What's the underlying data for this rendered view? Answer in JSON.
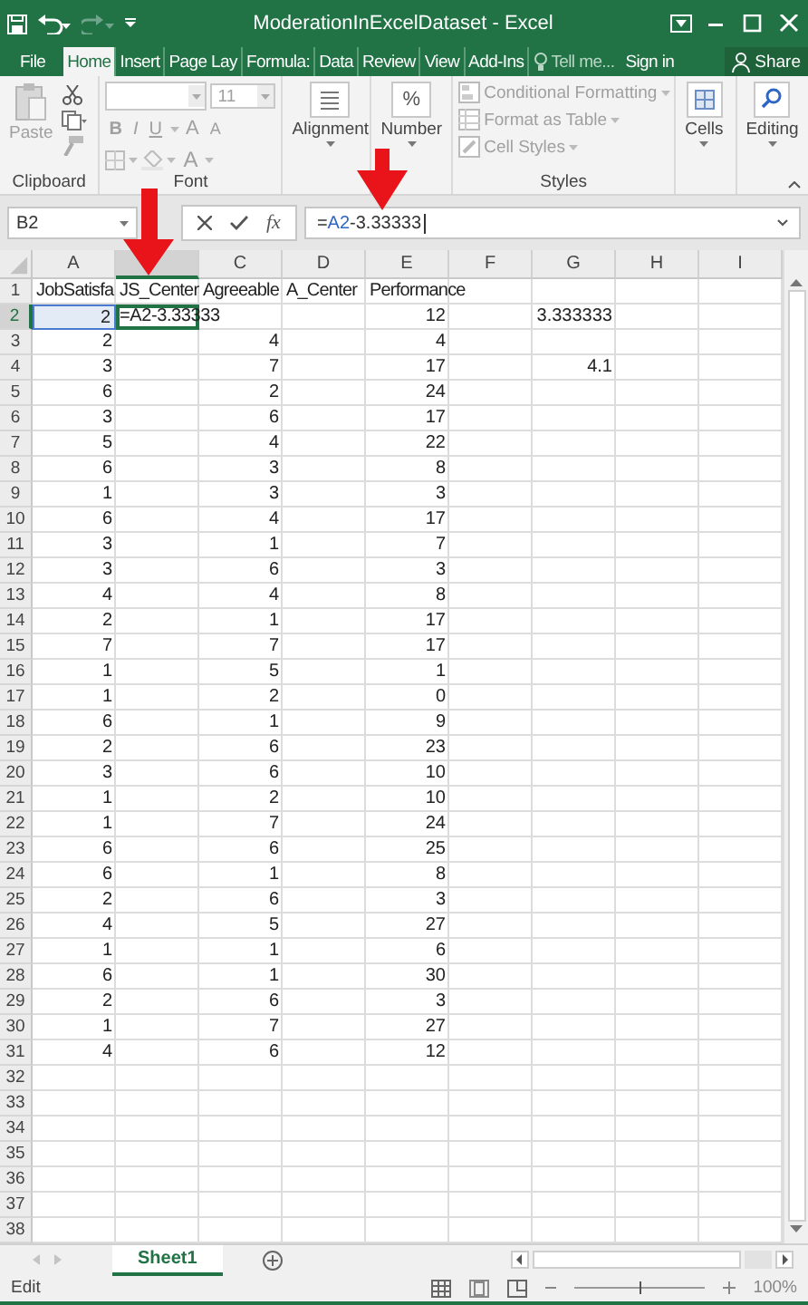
{
  "window": {
    "title": "ModerationInExcelDataset - Excel"
  },
  "ribbon_tabs": [
    {
      "label": "File",
      "selected": false
    },
    {
      "label": "Home",
      "selected": true
    },
    {
      "label": "Insert",
      "selected": false
    },
    {
      "label": "Page Lay",
      "selected": false
    },
    {
      "label": "Formula:",
      "selected": false
    },
    {
      "label": "Data",
      "selected": false
    },
    {
      "label": "Review",
      "selected": false
    },
    {
      "label": "View",
      "selected": false
    },
    {
      "label": "Add-Ins",
      "selected": false
    }
  ],
  "tell_me": {
    "placeholder": "Tell me..."
  },
  "account": {
    "sign_in": "Sign in",
    "share": "Share"
  },
  "ribbon": {
    "clipboard": {
      "label": "Clipboard",
      "paste": "Paste"
    },
    "font": {
      "label": "Font",
      "size": "11",
      "style_buttons": [
        "B",
        "I",
        "U"
      ],
      "size_buttons": [
        "A",
        "A"
      ],
      "color_button": "A"
    },
    "alignment": {
      "label": "Alignment"
    },
    "number": {
      "label": "Number",
      "symbol": "%"
    },
    "styles": {
      "label": "Styles",
      "items": [
        {
          "label": "Conditional Formatting",
          "disabled": true
        },
        {
          "label": "Format as Table",
          "disabled": true
        },
        {
          "label": "Cell Styles",
          "disabled": true
        }
      ]
    },
    "cells": {
      "label": "Cells"
    },
    "editing": {
      "label": "Editing"
    }
  },
  "formula_bar": {
    "name_box": "B2",
    "function_label": "fx",
    "formula": [
      {
        "text": "=",
        "kind": "plain"
      },
      {
        "text": "A2",
        "kind": "reference"
      },
      {
        "text": "-3.33333",
        "kind": "plain"
      }
    ]
  },
  "columns": [
    {
      "label": "A",
      "selected": false
    },
    {
      "selected": true
    },
    {
      "label": "C",
      "selected": false
    },
    {
      "label": "D",
      "selected": false
    },
    {
      "label": "E",
      "selected": false
    },
    {
      "label": "F",
      "selected": false
    },
    {
      "label": "G",
      "selected": false
    },
    {
      "label": "H",
      "selected": false
    },
    {
      "label": "I",
      "selected": false
    }
  ],
  "rows": [
    {
      "label": "1",
      "selected": false,
      "cells": [
        {
          "text": "JobSatisfa",
          "kind": "label"
        },
        {
          "text": "JS_Center",
          "kind": "label"
        },
        {
          "text": "Agreeable",
          "kind": "label"
        },
        {
          "text": "A_Center",
          "kind": "label"
        },
        {
          "text": "Performance",
          "kind": "label"
        }
      ]
    },
    {
      "label": "2",
      "selected": true,
      "cells": [
        {
          "text": "2",
          "kind": "reference"
        },
        {
          "text": "=A2-3.33333",
          "kind": "editing"
        },
        {
          "kind": "blank"
        },
        {
          "kind": "blank"
        },
        {
          "text": "12",
          "kind": "number"
        },
        {
          "kind": "blank"
        },
        {
          "text": "3.333333",
          "kind": "number"
        }
      ]
    },
    {
      "label": "3",
      "selected": false,
      "cells": [
        {
          "text": "2",
          "kind": "number"
        },
        {
          "kind": "blank"
        },
        {
          "text": "4",
          "kind": "number"
        },
        {
          "kind": "blank"
        },
        {
          "text": "4",
          "kind": "number"
        }
      ]
    },
    {
      "label": "4",
      "selected": false,
      "cells": [
        {
          "text": "3",
          "kind": "number"
        },
        {
          "kind": "blank"
        },
        {
          "text": "7",
          "kind": "number"
        },
        {
          "kind": "blank"
        },
        {
          "text": "17",
          "kind": "number"
        },
        {
          "kind": "blank"
        },
        {
          "text": "4.1",
          "kind": "number"
        }
      ]
    },
    {
      "label": "5",
      "selected": false,
      "cells": [
        {
          "text": "6",
          "kind": "number"
        },
        {
          "kind": "blank"
        },
        {
          "text": "2",
          "kind": "number"
        },
        {
          "kind": "blank"
        },
        {
          "text": "24",
          "kind": "number"
        }
      ]
    },
    {
      "label": "6",
      "selected": false,
      "cells": [
        {
          "text": "3",
          "kind": "number"
        },
        {
          "kind": "blank"
        },
        {
          "text": "6",
          "kind": "number"
        },
        {
          "kind": "blank"
        },
        {
          "text": "17",
          "kind": "number"
        }
      ]
    },
    {
      "label": "7",
      "selected": false,
      "cells": [
        {
          "text": "5",
          "kind": "number"
        },
        {
          "kind": "blank"
        },
        {
          "text": "4",
          "kind": "number"
        },
        {
          "kind": "blank"
        },
        {
          "text": "22",
          "kind": "number"
        }
      ]
    },
    {
      "label": "8",
      "selected": false,
      "cells": [
        {
          "text": "6",
          "kind": "number"
        },
        {
          "kind": "blank"
        },
        {
          "text": "3",
          "kind": "number"
        },
        {
          "kind": "blank"
        },
        {
          "text": "8",
          "kind": "number"
        }
      ]
    },
    {
      "label": "9",
      "selected": false,
      "cells": [
        {
          "text": "1",
          "kind": "number"
        },
        {
          "kind": "blank"
        },
        {
          "text": "3",
          "kind": "number"
        },
        {
          "kind": "blank"
        },
        {
          "text": "3",
          "kind": "number"
        }
      ]
    },
    {
      "label": "10",
      "selected": false,
      "cells": [
        {
          "text": "6",
          "kind": "number"
        },
        {
          "kind": "blank"
        },
        {
          "text": "4",
          "kind": "number"
        },
        {
          "kind": "blank"
        },
        {
          "text": "17",
          "kind": "number"
        }
      ]
    },
    {
      "label": "11",
      "selected": false,
      "cells": [
        {
          "text": "3",
          "kind": "number"
        },
        {
          "kind": "blank"
        },
        {
          "text": "1",
          "kind": "number"
        },
        {
          "kind": "blank"
        },
        {
          "text": "7",
          "kind": "number"
        }
      ]
    },
    {
      "label": "12",
      "selected": false,
      "cells": [
        {
          "text": "3",
          "kind": "number"
        },
        {
          "kind": "blank"
        },
        {
          "text": "6",
          "kind": "number"
        },
        {
          "kind": "blank"
        },
        {
          "text": "3",
          "kind": "number"
        }
      ]
    },
    {
      "label": "13",
      "selected": false,
      "cells": [
        {
          "text": "4",
          "kind": "number"
        },
        {
          "kind": "blank"
        },
        {
          "text": "4",
          "kind": "number"
        },
        {
          "kind": "blank"
        },
        {
          "text": "8",
          "kind": "number"
        }
      ]
    },
    {
      "label": "14",
      "selected": false,
      "cells": [
        {
          "text": "2",
          "kind": "number"
        },
        {
          "kind": "blank"
        },
        {
          "text": "1",
          "kind": "number"
        },
        {
          "kind": "blank"
        },
        {
          "text": "17",
          "kind": "number"
        }
      ]
    },
    {
      "label": "15",
      "selected": false,
      "cells": [
        {
          "text": "7",
          "kind": "number"
        },
        {
          "kind": "blank"
        },
        {
          "text": "7",
          "kind": "number"
        },
        {
          "kind": "blank"
        },
        {
          "text": "17",
          "kind": "number"
        }
      ]
    },
    {
      "label": "16",
      "selected": false,
      "cells": [
        {
          "text": "1",
          "kind": "number"
        },
        {
          "kind": "blank"
        },
        {
          "text": "5",
          "kind": "number"
        },
        {
          "kind": "blank"
        },
        {
          "text": "1",
          "kind": "number"
        }
      ]
    },
    {
      "label": "17",
      "selected": false,
      "cells": [
        {
          "text": "1",
          "kind": "number"
        },
        {
          "kind": "blank"
        },
        {
          "text": "2",
          "kind": "number"
        },
        {
          "kind": "blank"
        },
        {
          "text": "0",
          "kind": "number"
        }
      ]
    },
    {
      "label": "18",
      "selected": false,
      "cells": [
        {
          "text": "6",
          "kind": "number"
        },
        {
          "kind": "blank"
        },
        {
          "text": "1",
          "kind": "number"
        },
        {
          "kind": "blank"
        },
        {
          "text": "9",
          "kind": "number"
        }
      ]
    },
    {
      "label": "19",
      "selected": false,
      "cells": [
        {
          "text": "2",
          "kind": "number"
        },
        {
          "kind": "blank"
        },
        {
          "text": "6",
          "kind": "number"
        },
        {
          "kind": "blank"
        },
        {
          "text": "23",
          "kind": "number"
        }
      ]
    },
    {
      "label": "20",
      "selected": false,
      "cells": [
        {
          "text": "3",
          "kind": "number"
        },
        {
          "kind": "blank"
        },
        {
          "text": "6",
          "kind": "number"
        },
        {
          "kind": "blank"
        },
        {
          "text": "10",
          "kind": "number"
        }
      ]
    },
    {
      "label": "21",
      "selected": false,
      "cells": [
        {
          "text": "1",
          "kind": "number"
        },
        {
          "kind": "blank"
        },
        {
          "text": "2",
          "kind": "number"
        },
        {
          "kind": "blank"
        },
        {
          "text": "10",
          "kind": "number"
        }
      ]
    },
    {
      "label": "22",
      "selected": false,
      "cells": [
        {
          "text": "1",
          "kind": "number"
        },
        {
          "kind": "blank"
        },
        {
          "text": "7",
          "kind": "number"
        },
        {
          "kind": "blank"
        },
        {
          "text": "24",
          "kind": "number"
        }
      ]
    },
    {
      "label": "23",
      "selected": false,
      "cells": [
        {
          "text": "6",
          "kind": "number"
        },
        {
          "kind": "blank"
        },
        {
          "text": "6",
          "kind": "number"
        },
        {
          "kind": "blank"
        },
        {
          "text": "25",
          "kind": "number"
        }
      ]
    },
    {
      "label": "24",
      "selected": false,
      "cells": [
        {
          "text": "6",
          "kind": "number"
        },
        {
          "kind": "blank"
        },
        {
          "text": "1",
          "kind": "number"
        },
        {
          "kind": "blank"
        },
        {
          "text": "8",
          "kind": "number"
        }
      ]
    },
    {
      "label": "25",
      "selected": false,
      "cells": [
        {
          "text": "2",
          "kind": "number"
        },
        {
          "kind": "blank"
        },
        {
          "text": "6",
          "kind": "number"
        },
        {
          "kind": "blank"
        },
        {
          "text": "3",
          "kind": "number"
        }
      ]
    },
    {
      "label": "26",
      "selected": false,
      "cells": [
        {
          "text": "4",
          "kind": "number"
        },
        {
          "kind": "blank"
        },
        {
          "text": "5",
          "kind": "number"
        },
        {
          "kind": "blank"
        },
        {
          "text": "27",
          "kind": "number"
        }
      ]
    },
    {
      "label": "27",
      "selected": false,
      "cells": [
        {
          "text": "1",
          "kind": "number"
        },
        {
          "kind": "blank"
        },
        {
          "text": "1",
          "kind": "number"
        },
        {
          "kind": "blank"
        },
        {
          "text": "6",
          "kind": "number"
        }
      ]
    },
    {
      "label": "28",
      "selected": false,
      "cells": [
        {
          "text": "6",
          "kind": "number"
        },
        {
          "kind": "blank"
        },
        {
          "text": "1",
          "kind": "number"
        },
        {
          "kind": "blank"
        },
        {
          "text": "30",
          "kind": "number"
        }
      ]
    },
    {
      "label": "29",
      "selected": false,
      "cells": [
        {
          "text": "2",
          "kind": "number"
        },
        {
          "kind": "blank"
        },
        {
          "text": "6",
          "kind": "number"
        },
        {
          "kind": "blank"
        },
        {
          "text": "3",
          "kind": "number"
        }
      ]
    },
    {
      "label": "30",
      "selected": false,
      "cells": [
        {
          "text": "1",
          "kind": "number"
        },
        {
          "kind": "blank"
        },
        {
          "text": "7",
          "kind": "number"
        },
        {
          "kind": "blank"
        },
        {
          "text": "27",
          "kind": "number"
        }
      ]
    },
    {
      "label": "31",
      "selected": false,
      "cells": [
        {
          "text": "4",
          "kind": "number"
        },
        {
          "kind": "blank"
        },
        {
          "text": "6",
          "kind": "number"
        },
        {
          "kind": "blank"
        },
        {
          "text": "12",
          "kind": "number"
        }
      ]
    },
    {
      "label": "32",
      "selected": false
    },
    {
      "label": "33",
      "selected": false
    },
    {
      "label": "34",
      "selected": false
    },
    {
      "label": "35",
      "selected": false
    },
    {
      "label": "36",
      "selected": false
    },
    {
      "label": "37",
      "selected": false
    },
    {
      "label": "38",
      "selected": false
    }
  ],
  "sheet_tabs": [
    {
      "label": "Sheet1",
      "selected": true
    }
  ],
  "status_bar": {
    "mode": "Edit",
    "zoom": {
      "level": 0.5,
      "reading": "100%"
    }
  }
}
